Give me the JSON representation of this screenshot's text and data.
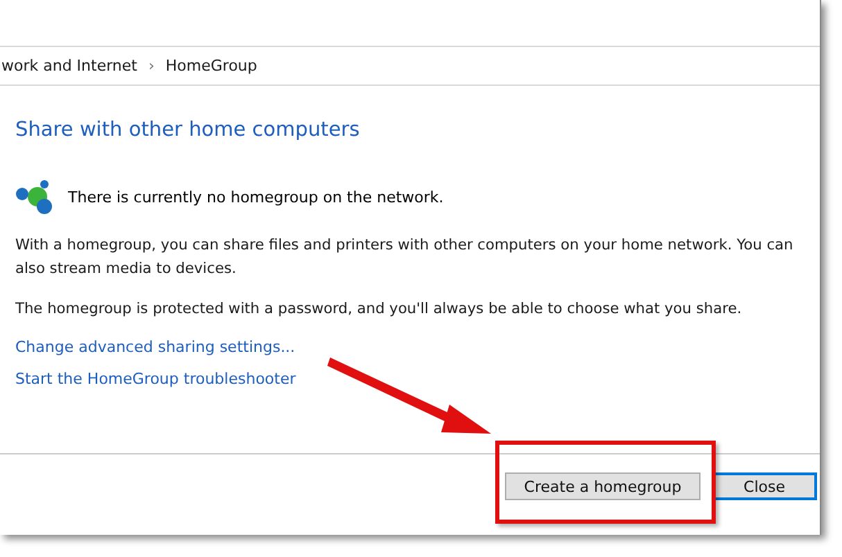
{
  "breadcrumb": [
    "work and Internet",
    "HomeGroup"
  ],
  "breadcrumb_separator": "›",
  "heading": "Share with other home computers",
  "status": "There is currently no homegroup on the network.",
  "paragraphs": [
    "With a homegroup, you can share files and printers with other computers on your home network. You can also stream media to devices.",
    "The homegroup is protected with a password, and you'll always be able to choose what you share."
  ],
  "links": [
    "Change advanced sharing settings...",
    "Start the HomeGroup troubleshooter"
  ],
  "buttons": [
    {
      "label": "Create a homegroup",
      "focused": false,
      "highlighted": true
    },
    {
      "label": "Close",
      "focused": true,
      "highlighted": false
    }
  ]
}
